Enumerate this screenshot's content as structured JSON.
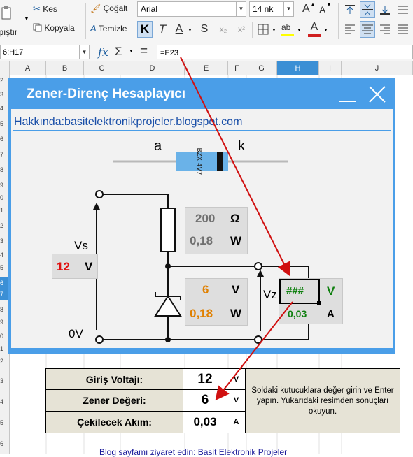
{
  "ribbon": {
    "paste_label": "ıpıştır",
    "cut_label": "Kes",
    "copy_label": "Kopyala",
    "clone_label": "Çoğalt",
    "clear_label": "Temizle",
    "font_name": "Arial",
    "font_size": "14 nk",
    "bold_label": "K",
    "italic_label": "T",
    "underline_label": "A",
    "strike_label": "S",
    "subscript_label": "x₂",
    "superscript_label": "x²",
    "grow_font_label": "A",
    "shrink_font_label": "A",
    "font_color": "#d02020",
    "highlight_color": "#ffff00"
  },
  "formula_bar": {
    "cell_ref": "6:H17",
    "function_label": "fx",
    "sum_label": "Σ",
    "equals_label": "=",
    "formula": "=E23"
  },
  "columns": [
    {
      "label": "A"
    },
    {
      "label": "B"
    },
    {
      "label": "C"
    },
    {
      "label": "D"
    },
    {
      "label": "E"
    },
    {
      "label": "F"
    },
    {
      "label": "G"
    },
    {
      "label": "H"
    },
    {
      "label": "I"
    },
    {
      "label": "J"
    }
  ],
  "row_numbers": [
    "2",
    "3",
    "4",
    "5",
    "6",
    "7",
    "8",
    "9",
    "0",
    "1",
    "2",
    "3",
    "4",
    "5",
    "6",
    "7",
    "8",
    "9",
    "0",
    "1",
    "2",
    "3",
    "4",
    "5",
    "6"
  ],
  "dialog": {
    "title": "Zener-Direnç Hesaplayıcı",
    "about_link": "Hakkında:basitelektronikprojeler.blogspot.com",
    "diode_anode": "a",
    "diode_cathode": "k",
    "diode_marking": "BZX 4V7",
    "resistor_value": "200",
    "resistor_unit": "Ω",
    "resistor_power": "0,18",
    "resistor_power_unit": "W",
    "vs_label": "Vs",
    "vs_value": "12",
    "vs_unit": "V",
    "zener_voltage": "6",
    "zener_voltage_unit": "V",
    "zener_power": "0,18",
    "zener_power_unit": "W",
    "vz_label": "Vz",
    "out_value": "###",
    "out_unit": "V",
    "out_current": "0,03",
    "out_current_unit": "A",
    "ground_label": "0V"
  },
  "table": {
    "rows": [
      {
        "label": "Giriş Voltajı:",
        "value": "12",
        "unit": "V"
      },
      {
        "label": "Zener Değeri:",
        "value": "6",
        "unit": "V"
      },
      {
        "label": "Çekilecek Akım:",
        "value": "0,03",
        "unit": "A"
      }
    ],
    "note": "Soldaki kutucuklara değer girin ve Enter yapın. Yukarıdaki resimden sonuçları okuyun."
  },
  "footer_link": "Blog sayfamı ziyaret edin: Basit Elektronik Projeler",
  "colors": {
    "accent": "#3b8fd5",
    "dialog_frame": "#4a9ee8",
    "arrow": "#d01010",
    "red_value": "#e01010",
    "orange_value": "#e08000",
    "green_value": "#108010",
    "gray_value": "#707070"
  }
}
